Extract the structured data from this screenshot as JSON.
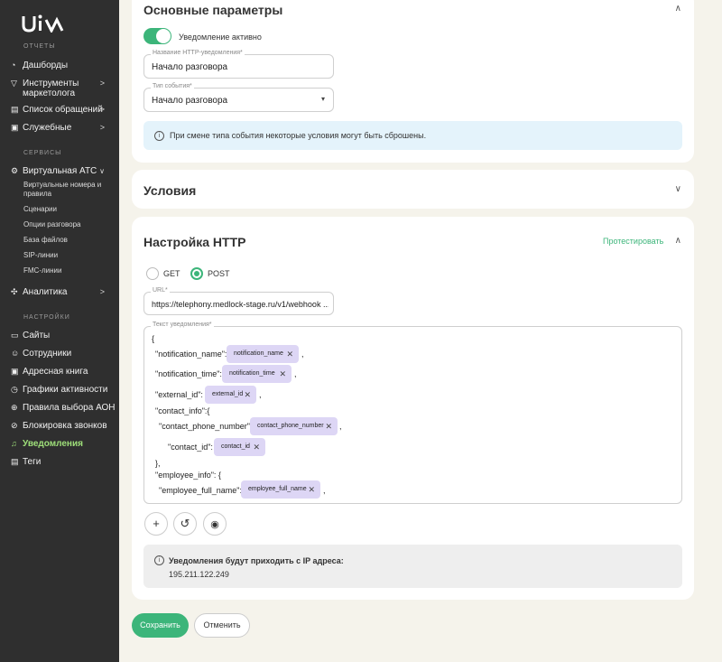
{
  "sidebar": {
    "logo_text": "uiv",
    "sections": {
      "reports": "ОТЧЕТЫ",
      "services": "СЕРВИСЫ",
      "settings": "НАСТРОЙКИ"
    },
    "items": {
      "dashboards": "Дашборды",
      "marketing_tools": "Инструменты маркетолога",
      "requests": "Список обращений",
      "service": "Служебные",
      "vpbx": "Виртуальная АТС",
      "analytics": "Аналитика",
      "sites": "Сайты",
      "employees": "Сотрудники",
      "address_book": "Адресная книга",
      "activity": "Графики активности",
      "aon_rules": "Правила выбора АОН",
      "call_block": "Блокировка звонков",
      "notifications": "Уведомления",
      "tags": "Теги"
    },
    "subitems": {
      "virtual_numbers": "Виртуальные номера и правила",
      "scenarios": "Сценарии",
      "call_options": "Опции разговора",
      "files": "База файлов",
      "sip": "SIP-линии",
      "fmc": "FMC-линии"
    },
    "arrow": ">"
  },
  "basic": {
    "title": "Основные параметры",
    "toggle_label": "Уведомление активно",
    "name_label": "Название HTTP-уведомления*",
    "name_value": "Начало разговора",
    "event_label": "Тип события*",
    "event_value": "Начало разговора",
    "info": "При смене типа события некоторые условия могут быть сброшены."
  },
  "conditions": {
    "title": "Условия"
  },
  "http": {
    "title": "Настройка HTTP",
    "test_link": "Протестировать",
    "method_get": "GET",
    "method_post": "POST",
    "url_label": "URL*",
    "url_value": "https://telephony.medlock-stage.ru/v1/webhook ...",
    "body_label": "Текст уведомления*",
    "body": {
      "open_brace": "{",
      "notification_name_key": "\"notification_name\":",
      "notification_name_chip": "notification_name",
      "notification_time_key": "\"notification_time\":",
      "notification_time_chip": "notification_time",
      "external_id_key": "\"external_id\":",
      "external_id_chip": "external_id",
      "contact_info_key": "\"contact_info\":{",
      "contact_phone_key": "\"contact_phone_number\":",
      "contact_phone_chip": "contact_phone_number",
      "contact_id_key": "\"contact_id\":",
      "contact_id_chip": "contact_id",
      "close_contact": "},",
      "employee_info_key": "\"employee_info\": {",
      "employee_name_key": "\"employee_full_name\":",
      "employee_name_chip": "employee_full_name",
      "comma": ","
    },
    "ip_title": "Уведомления будут приходить с IP адреса:",
    "ip_value": "195.211.122.249"
  },
  "actions": {
    "save": "Сохранить",
    "cancel": "Отменить"
  },
  "colors": {
    "accent": "#3cb57a",
    "chip": "#ddd6f5",
    "info_bg": "#e4f3fb",
    "sidebar": "#2f2f2f"
  }
}
